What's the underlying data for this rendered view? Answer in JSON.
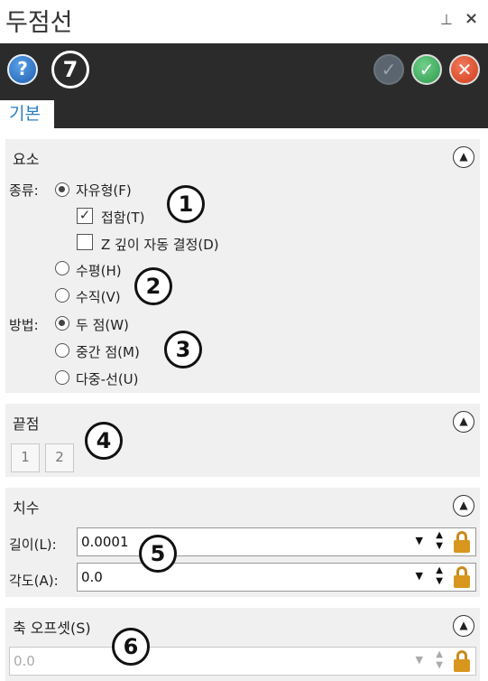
{
  "window": {
    "title": "두점선",
    "pin": "⊥",
    "close": "×"
  },
  "toolbar": {
    "help": "?",
    "badge": "7",
    "apply": "✓",
    "ok": "✓",
    "cancel": "✕"
  },
  "tab": {
    "label": "기본"
  },
  "elements": {
    "title": "요소",
    "type_label": "종류:",
    "type_options": [
      {
        "label": "자유형(F)",
        "selected": true
      },
      {
        "label": "수평(H)",
        "selected": false
      },
      {
        "label": "수직(V)",
        "selected": false
      }
    ],
    "tangent": {
      "label": "접함(T)",
      "checked": true
    },
    "auto_z": {
      "label": "Z 깊이 자동 결정(D)",
      "checked": false
    },
    "method_label": "방법:",
    "method_options": [
      {
        "label": "두 점(W)",
        "selected": true
      },
      {
        "label": "중간 점(M)",
        "selected": false
      },
      {
        "label": "다중-선(U)",
        "selected": false
      }
    ],
    "badges": [
      "1",
      "2",
      "3"
    ]
  },
  "endpoints": {
    "title": "끝점",
    "points": [
      "1",
      "2"
    ],
    "badge": "4"
  },
  "dimensions": {
    "title": "치수",
    "length": {
      "label": "길이(L):",
      "value": "0.0001"
    },
    "angle": {
      "label": "각도(A):",
      "value": "0.0"
    },
    "badge": "5"
  },
  "offset": {
    "title": "축 오프셋(S)",
    "value": "0.0",
    "badge": "6"
  },
  "controls": {
    "dropdown": "▼",
    "spin_up": "▲",
    "spin_down": "▼",
    "collapse": "▲"
  }
}
